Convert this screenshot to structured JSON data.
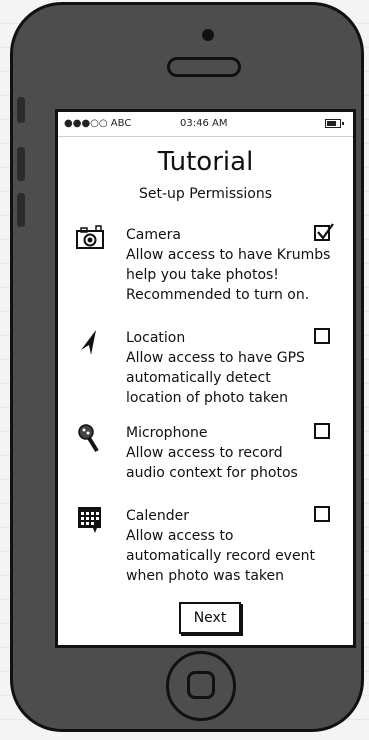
{
  "status_bar": {
    "carrier": "●●●○○ ABC",
    "time": "03:46 AM"
  },
  "title": "Tutorial",
  "subtitle": "Set-up Permissions",
  "permissions": [
    {
      "icon": "camera-icon",
      "name": "Camera",
      "description": "Allow access to have Krumbs\nhelp you take photos!\nRecommended to turn on.",
      "checked": true
    },
    {
      "icon": "location-arrow-icon",
      "name": "Location",
      "description": "Allow access to have GPS\nautomatically detect\nlocation of photo taken",
      "checked": false
    },
    {
      "icon": "microphone-icon",
      "name": "Microphone",
      "description": "Allow access to record\naudio context for photos",
      "checked": false
    },
    {
      "icon": "calendar-icon",
      "name": "Calender",
      "description": "Allow access to\nautomatically record event\nwhen photo was taken",
      "checked": false
    }
  ],
  "next_button": "Next"
}
